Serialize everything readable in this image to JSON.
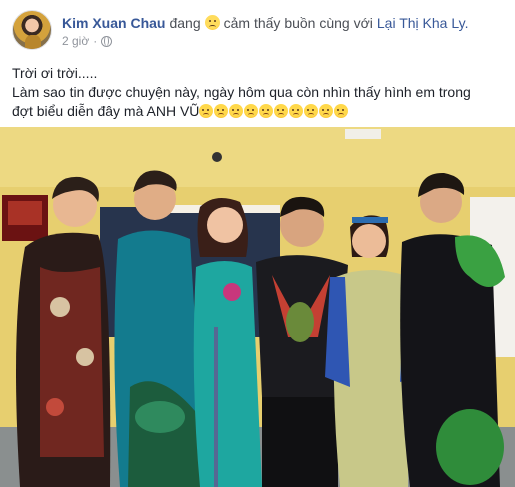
{
  "post": {
    "author": "Kim Xuan Chau",
    "verb": "đang",
    "feeling": "cảm thấy buồn cùng với",
    "tagged_user": "Lại Thị Kha Ly.",
    "timestamp": "2 giờ",
    "separator": "·",
    "privacy_icon": "globe-icon",
    "text_line1": "Trời ơi trời.....",
    "text_line2": "Làm sao tin được chuyện này, ngày hôm qua còn nhìn thấy hình em trong",
    "text_line3": "đợt biểu diễn đây mà ANH VŨ"
  },
  "colors": {
    "link": "#385898",
    "meta": "#90949c",
    "wall": "#e7cf6f"
  }
}
